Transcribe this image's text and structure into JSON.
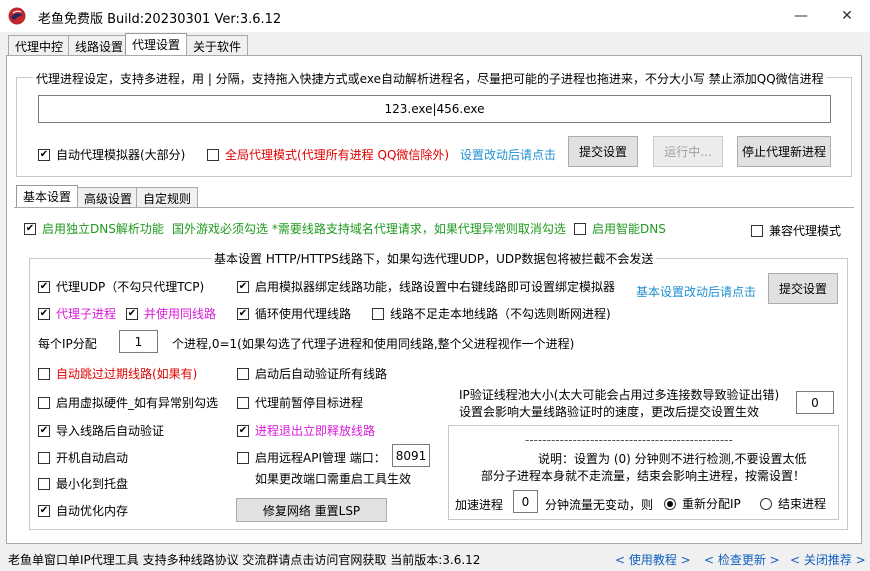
{
  "window": {
    "title": "老鱼免费版 Build:20230301 Ver:3.6.12",
    "minimize": "—",
    "close": "✕"
  },
  "tabs": [
    "代理中控",
    "线路设置",
    "代理设置",
    "关于软件"
  ],
  "proc": {
    "legend": "代理进程设定，支持多进程，用 | 分隔，支持拖入快捷方式或exe自动解析进程名，尽量把可能的子进程也拖进来，不分大小写 禁止添加QQ微信进程",
    "value": "123.exe|456.exe",
    "auto_simulator": "自动代理模拟器(大部分)",
    "global_mode": "全局代理模式(代理所有进程 QQ微信除外)",
    "hint": "设置改动后请点击",
    "submit": "提交设置",
    "running": "运行中...",
    "stop": "停止代理新进程"
  },
  "subtabs": [
    "基本设置",
    "高级设置",
    "自定规则"
  ],
  "dns": {
    "enable": "启用独立DNS解析功能",
    "note": "国外游戏必须勾选 *需要线路支持域名代理请求，如果代理异常则取消勾选",
    "smart": "启用智能DNS",
    "compat": "兼容代理模式"
  },
  "basic": {
    "legend": "基本设置 HTTP/HTTPS线路下，如果勾选代理UDP，UDP数据包将被拦截不会发送",
    "proxy_udp": "代理UDP（不勾只代理TCP)",
    "sim_bind": "启用模拟器绑定线路功能，线路设置中右键线路即可设置绑定模拟器",
    "hint": "基本设置改动后请点击",
    "submit": "提交设置",
    "child": "代理子进程",
    "same_line": "并使用同线路",
    "loop": "循环使用代理线路",
    "no_disconnect": "线路不足走本地线路（不勾选则断网进程)",
    "ip_label": "每个IP分配",
    "ip_value": "1",
    "ip_note": "个进程,0=1(如果勾选了代理子进程和使用同线路,整个父进程视作一个进程)",
    "skip_expired": "自动跳过过期线路(如果有)",
    "verify_on_start": "启动后自动验证所有线路",
    "virtual_hw": "启用虚拟硬件_如有异常别勾选",
    "pause_target": "代理前暂停目标进程",
    "import_verify": "导入线路后自动验证",
    "release_on_exit": "进程退出立即释放线路",
    "autostart": "开机自动启动",
    "remote_api": "启用远程API管理 端口：",
    "port": "8091",
    "port_note": "如果更改端口需重启工具生效",
    "tray": "最小化到托盘",
    "optimize": "自动优化内存",
    "repair": "修复网络 重置LSP",
    "pool_label": "IP验证线程池大小(太大可能会占用过多连接数导致验证出错)",
    "pool_label2": "设置会影响大量线路验证时的速度，更改后提交设置生效",
    "pool_value": "0",
    "accel_dashes": "------------------------------------------------",
    "accel_desc1": "说明：设置为 (0) 分钟则不进行检测,不要设置太低",
    "accel_desc2": "部分子进程本身就不走流量，结束会影响主进程，按需设置！",
    "accel_label": "加速进程",
    "accel_value": "0",
    "accel_mid": "分钟流量无变动，则",
    "reassign": "重新分配IP",
    "end_proc": "结束进程"
  },
  "status": {
    "text": "老鱼单窗口单IP代理工具 支持多种线路协议 交流群请点击访问官网获取  当前版本:3.6.12",
    "tutorial": "< 使用教程 >",
    "update": "< 检查更新 >",
    "close_rec": "< 关闭推荐 >"
  }
}
